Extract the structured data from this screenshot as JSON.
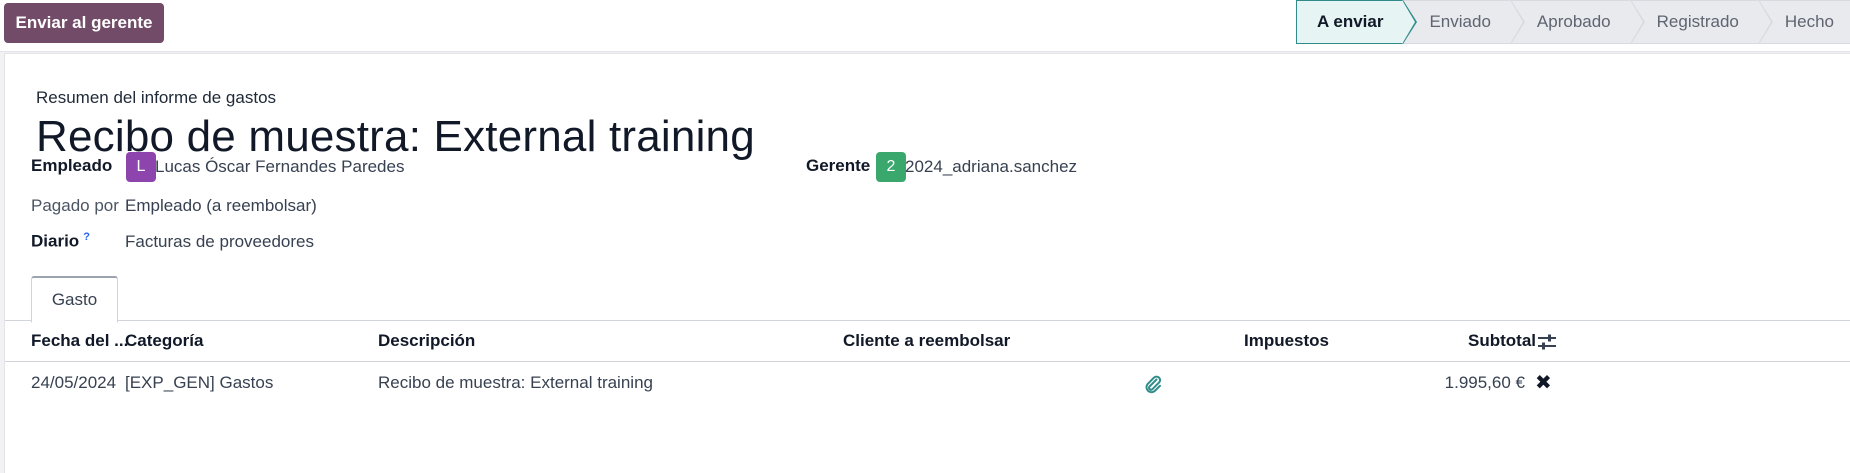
{
  "control_panel": {
    "send_button": "Enviar al gerente",
    "stages": [
      "A enviar",
      "Enviado",
      "Aprobado",
      "Registrado",
      "Hecho"
    ],
    "active_stage": "A enviar"
  },
  "form": {
    "subtitle": "Resumen del informe de gastos",
    "title": "Recibo de muestra: External training",
    "employee_label": "Empleado",
    "employee_avatar": "L",
    "employee_value": "Lucas Óscar Fernandes Paredes",
    "manager_label": "Gerente",
    "manager_avatar": "2",
    "manager_value": "2024_adriana.sanchez",
    "paid_by_label": "Pagado por",
    "paid_by_value": "Empleado (a reembolsar)",
    "journal_label": "Diario",
    "journal_help": "?",
    "journal_value": "Facturas de proveedores"
  },
  "tabs": [
    {
      "label": "Gasto"
    }
  ],
  "table": {
    "headers": [
      "Fecha del ...",
      "Categoría",
      "Descripción",
      "Cliente a reembolsar",
      "Impuestos",
      "Subtotal"
    ],
    "rows": [
      {
        "date": "24/05/2024",
        "category": "[EXP_GEN] Gastos",
        "description": "Recibo de muestra: External training",
        "customer": "",
        "taxes": "",
        "subtotal": "1.995,60 €"
      }
    ]
  },
  "colors": {
    "primary": "#714b67",
    "stage_active": "#2f8c8a",
    "avatar_employee": "#8e44ad",
    "avatar_manager": "#3aa76d"
  },
  "icons": [
    "optional-columns-icon",
    "paperclip-icon",
    "delete-icon"
  ]
}
